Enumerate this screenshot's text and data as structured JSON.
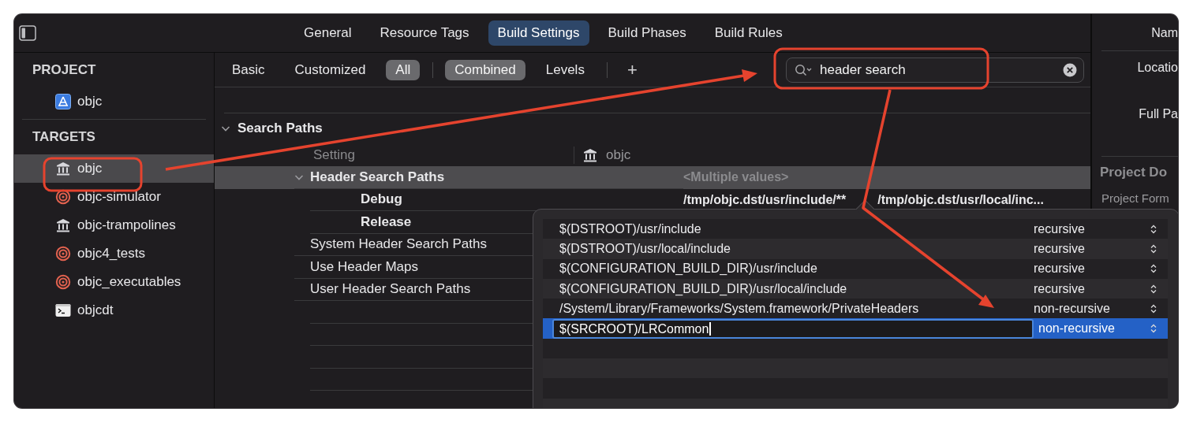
{
  "toolbar": {
    "tabs": [
      {
        "label": "General",
        "selected": false
      },
      {
        "label": "Resource Tags",
        "selected": false
      },
      {
        "label": "Build Settings",
        "selected": true
      },
      {
        "label": "Build Phases",
        "selected": false
      },
      {
        "label": "Build Rules",
        "selected": false
      }
    ]
  },
  "sidebar": {
    "sections": [
      {
        "title": "PROJECT",
        "items": [
          {
            "label": "objc",
            "kind": "project",
            "selected": false
          }
        ]
      },
      {
        "title": "TARGETS",
        "items": [
          {
            "label": "objc",
            "kind": "framework",
            "selected": true
          },
          {
            "label": "objc-simulator",
            "kind": "target",
            "selected": false
          },
          {
            "label": "objc-trampolines",
            "kind": "framework",
            "selected": false
          },
          {
            "label": "objc4_tests",
            "kind": "target",
            "selected": false
          },
          {
            "label": "objc_executables",
            "kind": "target",
            "selected": false
          },
          {
            "label": "objcdt",
            "kind": "tool",
            "selected": false
          }
        ]
      }
    ]
  },
  "filter_bar": {
    "scopes": [
      {
        "label": "Basic",
        "selected": false
      },
      {
        "label": "Customized",
        "selected": false
      },
      {
        "label": "All",
        "selected": true
      }
    ],
    "modes": [
      {
        "label": "Combined",
        "selected": true
      },
      {
        "label": "Levels",
        "selected": false
      }
    ],
    "add_button": "+",
    "search": {
      "value": "header search"
    }
  },
  "settings": {
    "section": {
      "title": "Search Paths",
      "expanded": true
    },
    "columns": [
      "Setting",
      "objc"
    ],
    "rows": [
      {
        "name": "Header Search Paths",
        "value": "<Multiple values>",
        "customized": true,
        "expanded": true,
        "selected": true,
        "children": [
          {
            "name": "Debug",
            "values": [
              "/tmp/objc.dst/usr/include/**",
              "/tmp/objc.dst/usr/local/inc..."
            ],
            "customized": true,
            "selected": false
          },
          {
            "name": "Release",
            "customized": true,
            "selected": false
          }
        ]
      },
      {
        "name": "System Header Search Paths",
        "customized": false,
        "selected": false
      },
      {
        "name": "Use Header Maps",
        "customized": false,
        "selected": false
      },
      {
        "name": "User Header Search Paths",
        "customized": false,
        "selected": false
      }
    ]
  },
  "path_editor": {
    "rows": [
      {
        "path": "$(DSTROOT)/usr/include",
        "recursion": "recursive",
        "selected": false,
        "editing": false
      },
      {
        "path": "$(DSTROOT)/usr/local/include",
        "recursion": "recursive",
        "selected": false,
        "editing": false
      },
      {
        "path": "$(CONFIGURATION_BUILD_DIR)/usr/include",
        "recursion": "recursive",
        "selected": false,
        "editing": false
      },
      {
        "path": "$(CONFIGURATION_BUILD_DIR)/usr/local/include",
        "recursion": "recursive",
        "selected": false,
        "editing": false
      },
      {
        "path": "/System/Library/Frameworks/System.framework/PrivateHeaders",
        "recursion": "non-recursive",
        "selected": false,
        "editing": false
      },
      {
        "path": "$(SRCROOT)/LRCommon",
        "recursion": "non-recursive",
        "selected": true,
        "editing": true
      }
    ]
  },
  "inspector": {
    "fields": [
      {
        "label": "Nam"
      },
      {
        "label": "Locatio"
      },
      {
        "label": "Full Pa"
      }
    ],
    "section_title": "Project Do",
    "cut_label": "Project Form"
  }
}
